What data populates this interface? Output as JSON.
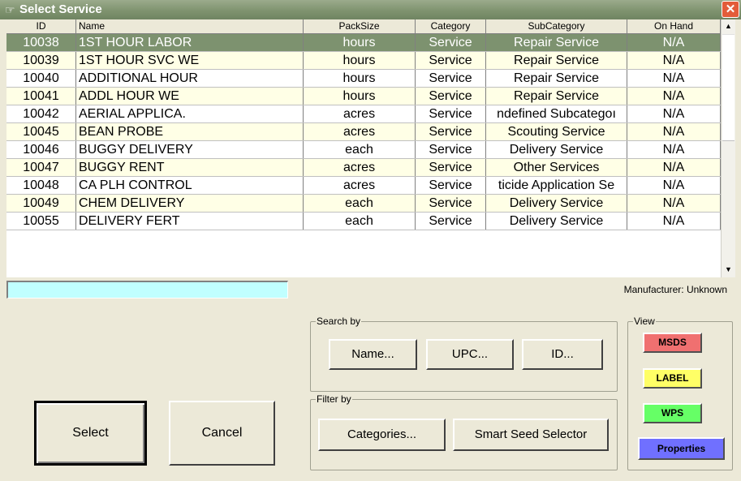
{
  "window": {
    "title": "Select Service",
    "title_icon": "hand-pointer-icon",
    "close_label": "✕"
  },
  "grid": {
    "columns": [
      {
        "key": "id",
        "label": "ID",
        "align": "center"
      },
      {
        "key": "name",
        "label": "Name",
        "align": "left"
      },
      {
        "key": "pack",
        "label": "PackSize",
        "align": "center"
      },
      {
        "key": "cat",
        "label": "Category",
        "align": "center"
      },
      {
        "key": "sub",
        "label": "SubCategory",
        "align": "center"
      },
      {
        "key": "onhand",
        "label": "On Hand",
        "align": "center"
      }
    ],
    "rows": [
      {
        "id": "10038",
        "name": "1ST HOUR LABOR",
        "pack": "hours",
        "cat": "Service",
        "sub": "Repair Service",
        "onhand": "N/A",
        "selected": true
      },
      {
        "id": "10039",
        "name": "1ST HOUR SVC WE",
        "pack": "hours",
        "cat": "Service",
        "sub": "Repair Service",
        "onhand": "N/A"
      },
      {
        "id": "10040",
        "name": "ADDITIONAL HOUR",
        "pack": "hours",
        "cat": "Service",
        "sub": "Repair Service",
        "onhand": "N/A"
      },
      {
        "id": "10041",
        "name": "ADDL HOUR WE",
        "pack": "hours",
        "cat": "Service",
        "sub": "Repair Service",
        "onhand": "N/A"
      },
      {
        "id": "10042",
        "name": "AERIAL APPLICA.",
        "pack": "acres",
        "cat": "Service",
        "sub": "ndefined Subcategoı",
        "onhand": "N/A"
      },
      {
        "id": "10045",
        "name": "BEAN PROBE",
        "pack": "acres",
        "cat": "Service",
        "sub": "Scouting Service",
        "onhand": "N/A"
      },
      {
        "id": "10046",
        "name": "BUGGY DELIVERY",
        "pack": "each",
        "cat": "Service",
        "sub": "Delivery Service",
        "onhand": "N/A"
      },
      {
        "id": "10047",
        "name": "BUGGY RENT",
        "pack": "acres",
        "cat": "Service",
        "sub": "Other Services",
        "onhand": "N/A"
      },
      {
        "id": "10048",
        "name": "CA PLH CONTROL",
        "pack": "acres",
        "cat": "Service",
        "sub": "ticide Application Se",
        "onhand": "N/A"
      },
      {
        "id": "10049",
        "name": "CHEM DELIVERY",
        "pack": "each",
        "cat": "Service",
        "sub": "Delivery Service",
        "onhand": "N/A"
      },
      {
        "id": "10055",
        "name": "DELIVERY FERT",
        "pack": "each",
        "cat": "Service",
        "sub": "Delivery Service",
        "onhand": "N/A"
      }
    ]
  },
  "colors": {
    "selected_row": "#7d926f",
    "alt_row": "#ffffe6",
    "search_box": "#c0ffff",
    "msds": "#f07070",
    "label": "#ffff66",
    "wps": "#66ff66",
    "properties": "#7070ff"
  },
  "search_input": {
    "value": ""
  },
  "manufacturer": "Manufacturer: Unknown",
  "search_by": {
    "label": "Search by",
    "name_btn": "Name...",
    "upc_btn": "UPC...",
    "id_btn": "ID..."
  },
  "filter_by": {
    "label": "Filter by",
    "categories_btn": "Categories...",
    "seed_btn": "Smart Seed Selector"
  },
  "view": {
    "label": "View",
    "msds": "MSDS",
    "label_btn": "LABEL",
    "wps": "WPS",
    "properties": "Properties"
  },
  "actions": {
    "select": "Select",
    "cancel": "Cancel"
  }
}
